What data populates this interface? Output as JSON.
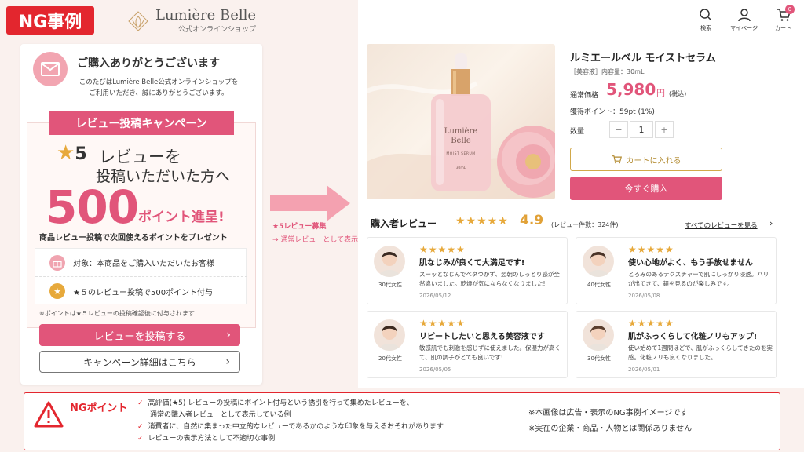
{
  "ng_badge": "NG事例",
  "brand": {
    "name": "Lumière Belle",
    "sub": "公式オンラインショップ"
  },
  "mail": {
    "title": "ご購入ありがとうございます",
    "body_l1": "このたびはLumière Belle公式オンラインショップを",
    "body_l2": "ご利用いただき、誠にありがとうございます。"
  },
  "campaign": {
    "banner": "レビュー投稿キャンペーン",
    "star": "★",
    "five": "5",
    "line1": "レビューを",
    "line2": "投稿いただいた方へ",
    "big": "500",
    "prize": "ポイント進呈!",
    "desc": "商品レビュー投稿で次回使えるポイントをプレゼント",
    "cond1": "対象：本商品をご購入いただいたお客様",
    "cond2": "★５のレビュー投稿で500ポイント付与",
    "note": "※ポイントは★５レビューの投稿確認後に付与されます",
    "btn_post": "レビューを投稿する",
    "btn_detail": "キャンペーン詳細はこちら"
  },
  "arrow": {
    "label1": "★5レビュー募集",
    "label2": "→ 通常レビューとして表示"
  },
  "header": {
    "search": "検索",
    "mypage": "マイページ",
    "cart": "カート",
    "cart_count": "0"
  },
  "product": {
    "title": "ルミエールベル モイストセラム",
    "category": "［美容液］内容量：30mL",
    "price_label": "通常価格",
    "price": "5,980",
    "price_unit": "円",
    "tax": "(税込)",
    "points": "獲得ポイント：59pt (1%)",
    "qty_label": "数量",
    "qty_minus": "−",
    "qty_value": "1",
    "qty_plus": "+",
    "btn_cart": "カートに入れる",
    "btn_buy": "今すぐ購入",
    "bottle_brand1": "Lumière",
    "bottle_brand2": "Belle",
    "bottle_label": "MOIST SERUM",
    "bottle_size": "30mL"
  },
  "reviews": {
    "heading": "購入者レビュー",
    "stars": "★★★★★",
    "score": "4.9",
    "count": "(レビュー件数：324件)",
    "see_all": "すべてのレビューを見る",
    "items": [
      {
        "stars": "★★★★★",
        "title": "肌なじみが良くて大満足です!",
        "body": "スーッとなじんでベタつかず、翌朝のしっとり感が全然違いました。乾燥が気にならなくなりました!",
        "age": "30代女性",
        "date": "2026/05/12"
      },
      {
        "stars": "★★★★★",
        "title": "使い心地がよく、もう手放せません",
        "body": "とろみのあるテクスチャーで肌にしっかり浸透。ハリが出てきて、鏡を見るのが楽しみです。",
        "age": "40代女性",
        "date": "2026/05/08"
      },
      {
        "stars": "★★★★★",
        "title": "リピートしたいと思える美容液です",
        "body": "敏感肌でも刺激を感じずに使えました。保湿力が高くて、肌の調子がとても良いです!",
        "age": "20代女性",
        "date": "2026/05/05"
      },
      {
        "stars": "★★★★★",
        "title": "肌がふっくらして化粧ノリもアップ!",
        "body": "使い始めて1週間ほどで、肌がふっくらしてきたのを実感。化粧ノリも良くなりました。",
        "age": "30代女性",
        "date": "2026/05/01"
      }
    ]
  },
  "ng": {
    "label": "NGポイント",
    "item1a": "高評価(★5) レビューの投稿にポイント付与という誘引を行って集めたレビューを、",
    "item1b": "通常の購入者レビューとして表示している例",
    "item2": "消費者に、自然に集まった中立的なレビューであるかのような印象を与えるおそれがあります",
    "item3": "レビューの表示方法として不適切な事例",
    "check": "✓",
    "disclaim1": "※本画像は広告・表示のNG事例イメージです",
    "disclaim2": "※実在の企業・商品・人物とは関係ありません"
  },
  "colors": {
    "accent": "#e1557a",
    "ng_red": "#e3262e",
    "star": "#e7a93b"
  }
}
